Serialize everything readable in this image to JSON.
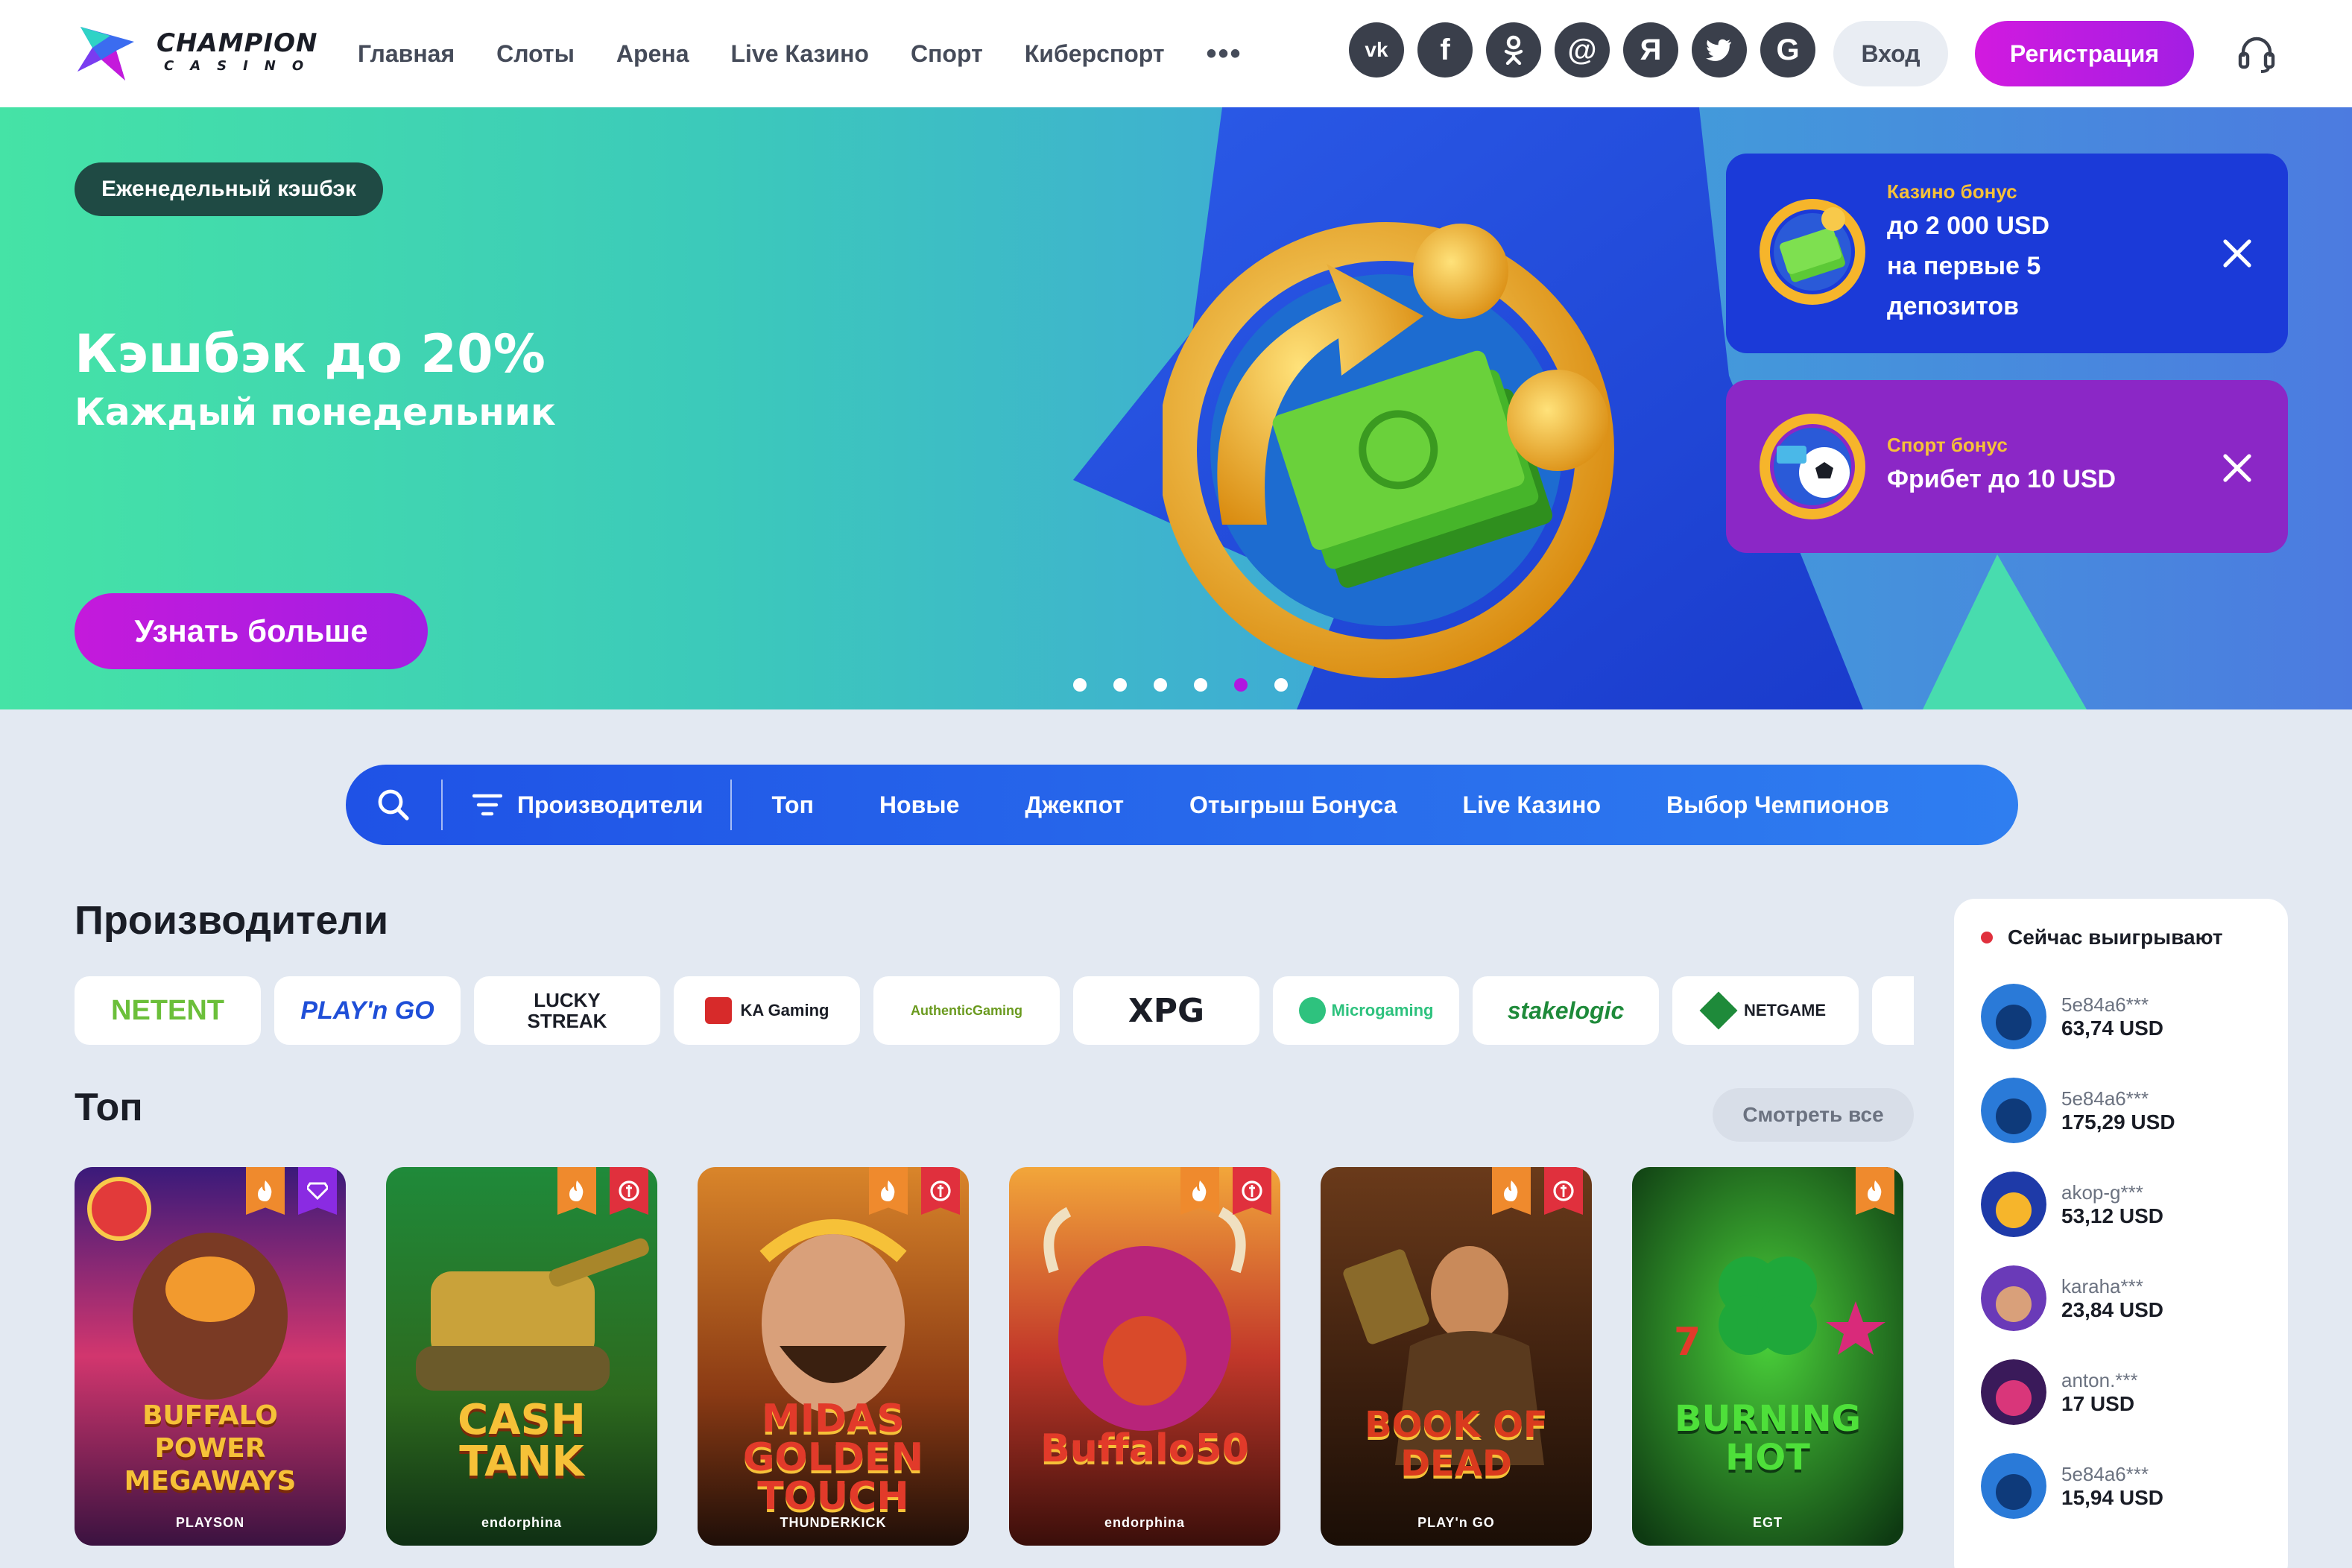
{
  "header": {
    "logo_text": "CHAMPION",
    "logo_subtext": "CASINO",
    "nav": [
      "Главная",
      "Слоты",
      "Арена",
      "Live Казино",
      "Спорт",
      "Киберспорт"
    ],
    "more": "•••",
    "socials": [
      {
        "icon": "vk-icon",
        "glyph": "vk"
      },
      {
        "icon": "facebook-icon",
        "glyph": "f"
      },
      {
        "icon": "odnoklassniki-icon",
        "glyph": "ok"
      },
      {
        "icon": "mailru-icon",
        "glyph": "@"
      },
      {
        "icon": "yandex-icon",
        "glyph": "Я"
      },
      {
        "icon": "twitter-icon",
        "glyph": "tw"
      },
      {
        "icon": "google-icon",
        "glyph": "G"
      }
    ],
    "login": "Вход",
    "register": "Регистрация"
  },
  "hero": {
    "badge": "Еженедельный кэшбэк",
    "title": "Кэшбэк до 20%",
    "subtitle": "Каждый понедельник",
    "cta": "Узнать больше",
    "slides_total": 6,
    "active_slide": 5
  },
  "promos": [
    {
      "kicker": "Казино бонус",
      "text": "до 2 000 USD\nна первые 5\nдепозитов"
    },
    {
      "kicker": "Спорт бонус",
      "text": "Фрибет до 10 USD"
    }
  ],
  "filters": {
    "producers": "Производители",
    "items": [
      "Топ",
      "Новые",
      "Джекпот",
      "Отыгрыш Бонуса",
      "Live Казино",
      "Выбор Чемпионов"
    ]
  },
  "producers": {
    "title": "Производители",
    "items": [
      "NETENT",
      "PLAY'n GO",
      "LUCKY STREAK",
      "KA Gaming",
      "AuthenticGaming",
      "XPG",
      "Microgaming",
      "stakelogic",
      "NETGAME"
    ]
  },
  "top": {
    "title": "Топ",
    "see_all": "Смотреть все",
    "games": [
      {
        "title": "BUFFALO\nPOWER\nMEGAWAYS",
        "provider": "PLAYSON",
        "tags": [
          "fire",
          "vip"
        ]
      },
      {
        "title": "CASH\nTANK",
        "provider": "endorphina",
        "tags": [
          "fire",
          "refund"
        ]
      },
      {
        "title": "MIDAS\nGOLDEN TOUCH",
        "provider": "THUNDERKICK",
        "tags": [
          "fire",
          "refund"
        ]
      },
      {
        "title": "Buffalo50",
        "provider": "endorphina",
        "tags": [
          "fire",
          "refund"
        ]
      },
      {
        "title": "BOOK OF\nDEAD",
        "provider": "PLAY'n GO",
        "tags": [
          "fire",
          "refund"
        ]
      },
      {
        "title": "BURNING\nHOT",
        "provider": "EGT",
        "tags": [
          "fire"
        ]
      }
    ]
  },
  "winners": {
    "title": "Сейчас выигрывают",
    "items": [
      {
        "name": "5e84a6***",
        "amount": "63,74 USD"
      },
      {
        "name": "5e84a6***",
        "amount": "175,29 USD"
      },
      {
        "name": "akop-g***",
        "amount": "53,12 USD"
      },
      {
        "name": "karaha***",
        "amount": "23,84 USD"
      },
      {
        "name": "anton.***",
        "amount": "17 USD"
      },
      {
        "name": "5e84a6***",
        "amount": "15,94 USD"
      }
    ]
  },
  "colors": {
    "accent_purple": "#c41adb",
    "filter_blue": "#2462ea",
    "casino_promo": "#1b3ad8",
    "sport_promo": "#8b27c6",
    "badge_green": "#1f4a44"
  }
}
